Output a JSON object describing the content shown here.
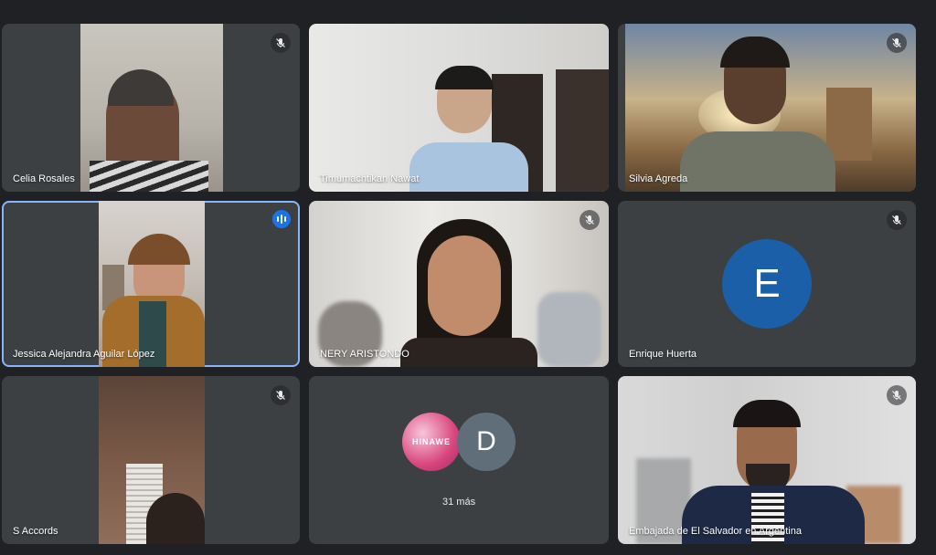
{
  "participants": [
    {
      "name": "Celia Rosales"
    },
    {
      "name": "Timumachtikan Nawat"
    },
    {
      "name": "Silvia Agreda"
    },
    {
      "name": "Jessica Alejandra Aguilar López"
    },
    {
      "name": "NERY ARISTONDO"
    },
    {
      "name": "Enrique Huerta",
      "initial": "E",
      "avatar_color": "#1a5fa8"
    },
    {
      "name": "S Accords"
    },
    {
      "name": "Embajada de El Salvador en Argentina"
    }
  ],
  "overflow": {
    "logo_text": "HINAWE",
    "initial": "D",
    "label": "31 más"
  },
  "icons": {
    "muted": "mic-off-icon",
    "speaking": "audio-level-icon"
  },
  "colors": {
    "background": "#202124",
    "tile": "#3c4043",
    "active_outline": "#8ab4f8",
    "speaking_badge": "#1a73e8"
  }
}
